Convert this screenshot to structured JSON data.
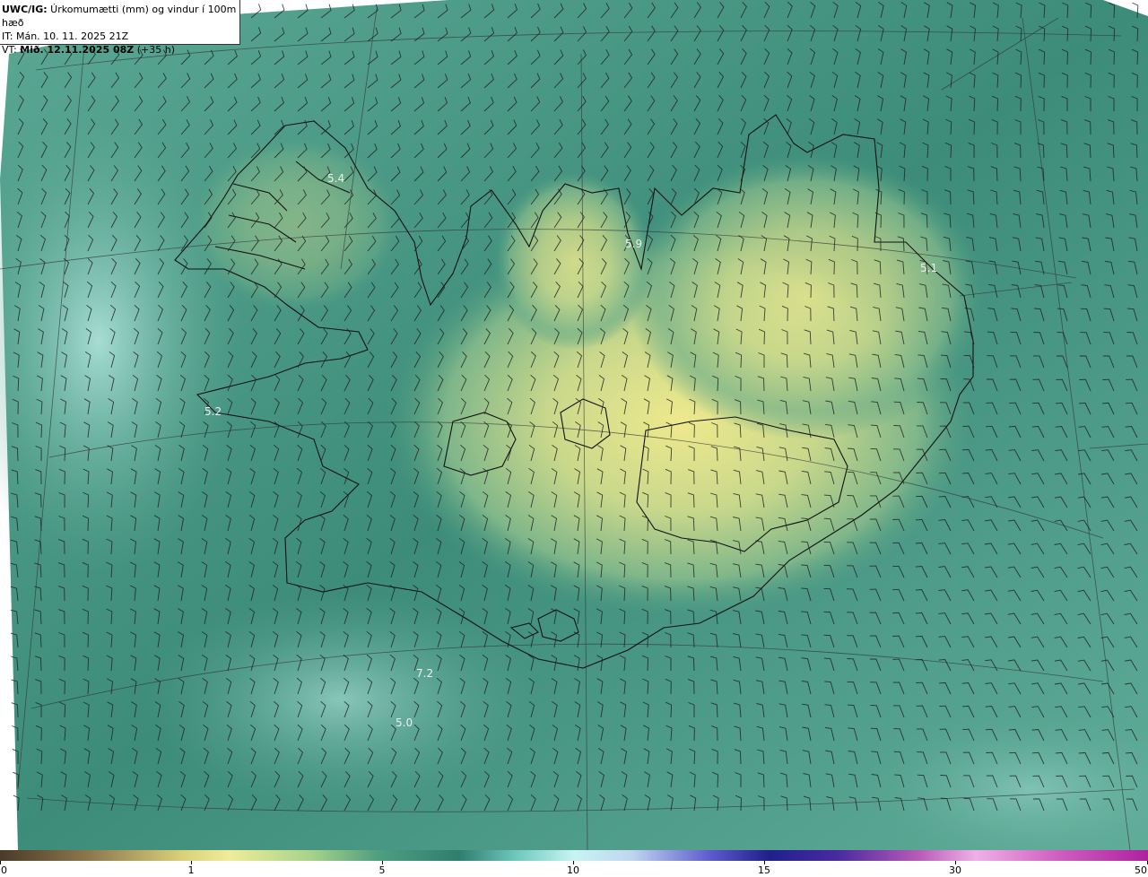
{
  "header": {
    "product": "UWC/IG:",
    "title": " Úrkomumætti (mm) og vindur í 100m hæð",
    "init_time": "IT: Mán. 10. 11. 2025 21Z",
    "valid_prefix": "VT: ",
    "valid_time": "Mið. 12.11.2025 08Z",
    "valid_offset": " (+35 h)"
  },
  "map": {
    "region": "Iceland",
    "background_color": "#3f8f7e",
    "coast_color": "#111111",
    "maxima_labels": [
      "5.4",
      "5.9",
      "5.1",
      "5.2",
      "7.2",
      "5.0"
    ]
  },
  "colorbar": {
    "ticks": [
      "0",
      "1",
      "5",
      "10",
      "15",
      "30",
      "50"
    ],
    "colors": [
      "#4a3a28",
      "#8f7a4f",
      "#d9d27a",
      "#f2ee9a",
      "#9fcf86",
      "#4e9e80",
      "#2f7e6e",
      "#6fc9bd",
      "#bff0ee",
      "#c8d8f0",
      "#5a5acc",
      "#20208a",
      "#4a2aa0",
      "#b85ab8",
      "#e890d8",
      "#c030a8"
    ]
  }
}
